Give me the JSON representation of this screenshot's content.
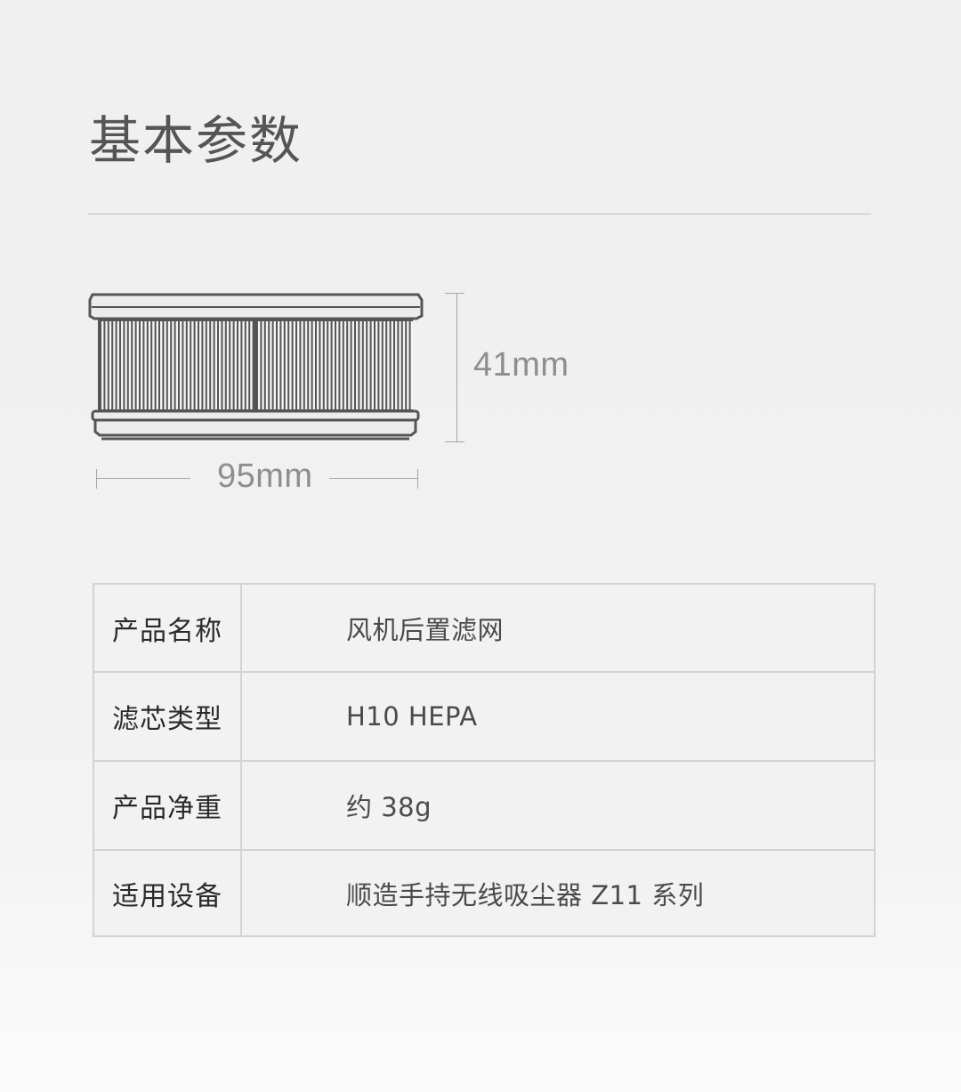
{
  "section_title": "基本参数",
  "dimensions": {
    "height_label": "41mm",
    "width_label": "95mm"
  },
  "product_figure": {
    "icon": "hepa-filter-icon",
    "frame_color": "#575757",
    "pleat_color": "#f4f4f4"
  },
  "specs": [
    {
      "key": "产品名称",
      "value": "风机后置滤网"
    },
    {
      "key": "滤芯类型",
      "value": "H10 HEPA"
    },
    {
      "key": "产品净重",
      "value": "约 38g"
    },
    {
      "key": "适用设备",
      "value": "顺造手持无线吸尘器 Z11 系列"
    }
  ]
}
